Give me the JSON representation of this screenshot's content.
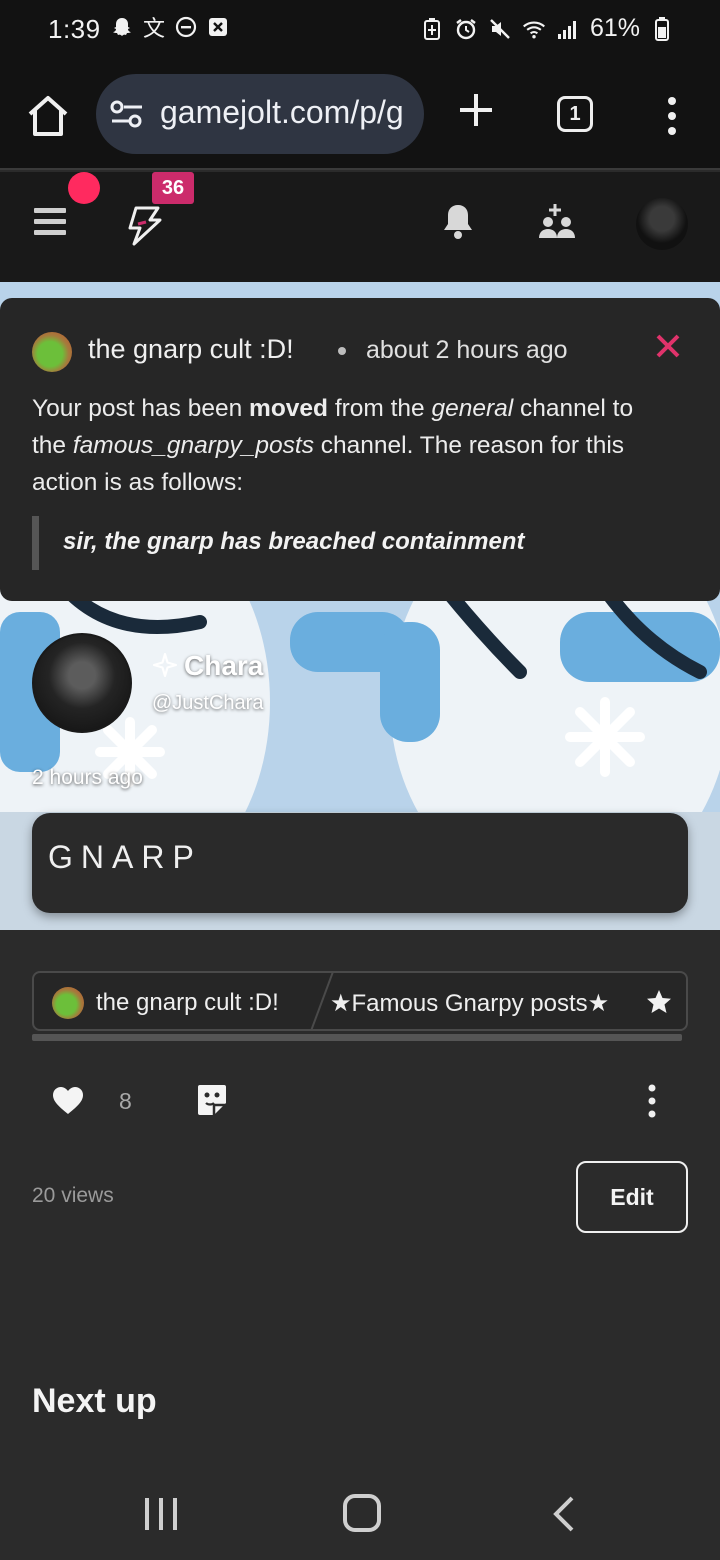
{
  "status_bar": {
    "time": "1:39",
    "battery_percent": "61%",
    "left_icons": [
      "snapchat-icon",
      "translate-icon",
      "dnd-icon",
      "close-box-icon"
    ],
    "right_icons": [
      "battery-saver-icon",
      "alarm-icon",
      "mute-icon",
      "wifi-icon",
      "signal-icon",
      "battery-icon"
    ]
  },
  "browser": {
    "url": "gamejolt.com/p/g",
    "tab_count": "1"
  },
  "site_nav": {
    "notification_badge": "36"
  },
  "notice": {
    "community": "the gnarp cult :D!",
    "time": "about 2 hours ago",
    "text_1": "Your post has been ",
    "text_bold": "moved",
    "text_2": " from the ",
    "from_channel": "general",
    "text_3": " channel to the ",
    "to_channel": "famous_gnarpy_posts",
    "text_4": " channel. The reason for this action is as follows:",
    "reason": "sir, the gnarp has breached containment"
  },
  "post": {
    "author_name": "Chara",
    "author_handle": "@JustChara",
    "time": "2 hours ago",
    "content": "GNARP",
    "community": "the gnarp cult :D!",
    "channel": "★Famous Gnarpy posts★",
    "likes": "8",
    "views": "20 views",
    "edit_label": "Edit"
  },
  "next_up": "Next up",
  "colors": {
    "accent_pink": "#cc2b6b",
    "red_dot": "#ff2a5f",
    "close_x": "#e0336b"
  }
}
